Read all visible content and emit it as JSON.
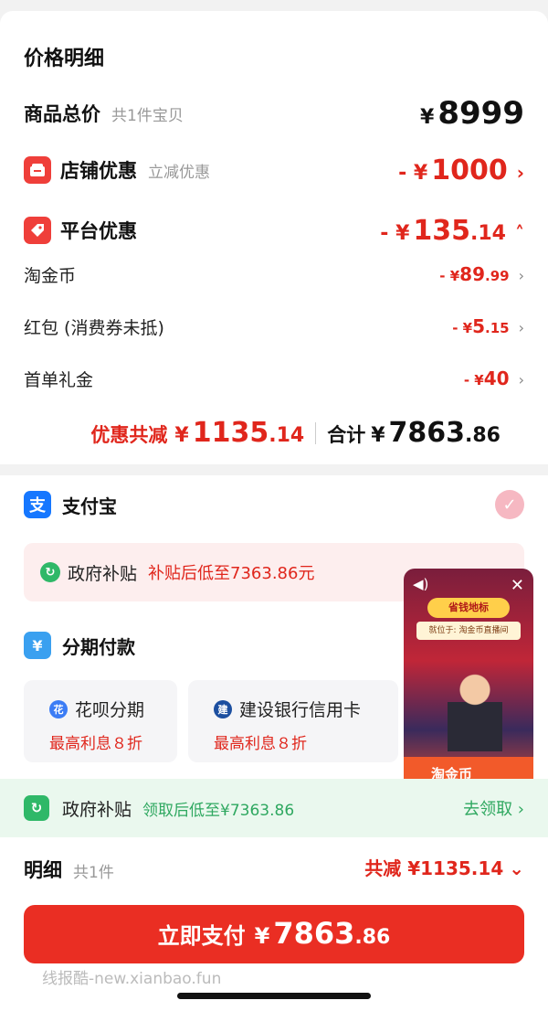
{
  "price_detail": {
    "title": "价格明细",
    "goods_total": {
      "label": "商品总价",
      "sub": "共1件宝贝",
      "yen": "¥",
      "amount": "8999"
    },
    "shop_discount": {
      "label": "店铺优惠",
      "sub": "立减优惠",
      "prefix": "- ¥",
      "amount": "1000"
    },
    "platform_discount": {
      "label": "平台优惠",
      "prefix": "- ¥",
      "amount": "135",
      "decimal": ".14"
    },
    "items": [
      {
        "label": "淘金币",
        "prefix": "- ¥",
        "amount": "89",
        "decimal": ".99"
      },
      {
        "label": "红包 (消费券未抵)",
        "prefix": "- ¥",
        "amount": "5",
        "decimal": ".15"
      },
      {
        "label": "首单礼金",
        "prefix": "- ¥",
        "amount": "40",
        "decimal": ""
      }
    ],
    "summary": {
      "discount_label": "优惠共减",
      "discount_yen": "¥",
      "discount_amount": "1135",
      "discount_decimal": ".14",
      "total_label": "合计",
      "total_yen": "¥",
      "total_amount": "7863",
      "total_decimal": ".86"
    }
  },
  "payment": {
    "alipay_label": "支付宝",
    "alipay_icon_glyph": "支",
    "gov_subsidy": {
      "label": "政府补贴",
      "text": "补贴后低至7363.86元"
    },
    "installment_label": "分期付款",
    "installment_options": [
      {
        "name": "花呗分期",
        "rate": "最高利息８折"
      },
      {
        "name": "建设银行信用卡",
        "rate": "最高利息８折"
      }
    ]
  },
  "gov_bar": {
    "label": "政府补贴",
    "text": "领取后低至¥7363.86",
    "action": "去领取 ›"
  },
  "detail": {
    "label": "明细",
    "sub": "共1件",
    "right_label": "共减 ¥",
    "right_amount": "1135.14",
    "chevron": "⌄"
  },
  "pay_button": {
    "label": "立即支付",
    "yen": "¥",
    "amount": "7863",
    "decimal": ".86"
  },
  "watermark": "线报酷-new.xianbao.fun",
  "floater": {
    "banner": "省钱地标",
    "sub": "就位于: 淘金币直播间",
    "coin_text": "淘金币"
  },
  "colors": {
    "accent_red": "#e0261c",
    "pay_button": "#ea2e23",
    "alipay_blue": "#1677ff",
    "gov_green": "#2fb868"
  }
}
